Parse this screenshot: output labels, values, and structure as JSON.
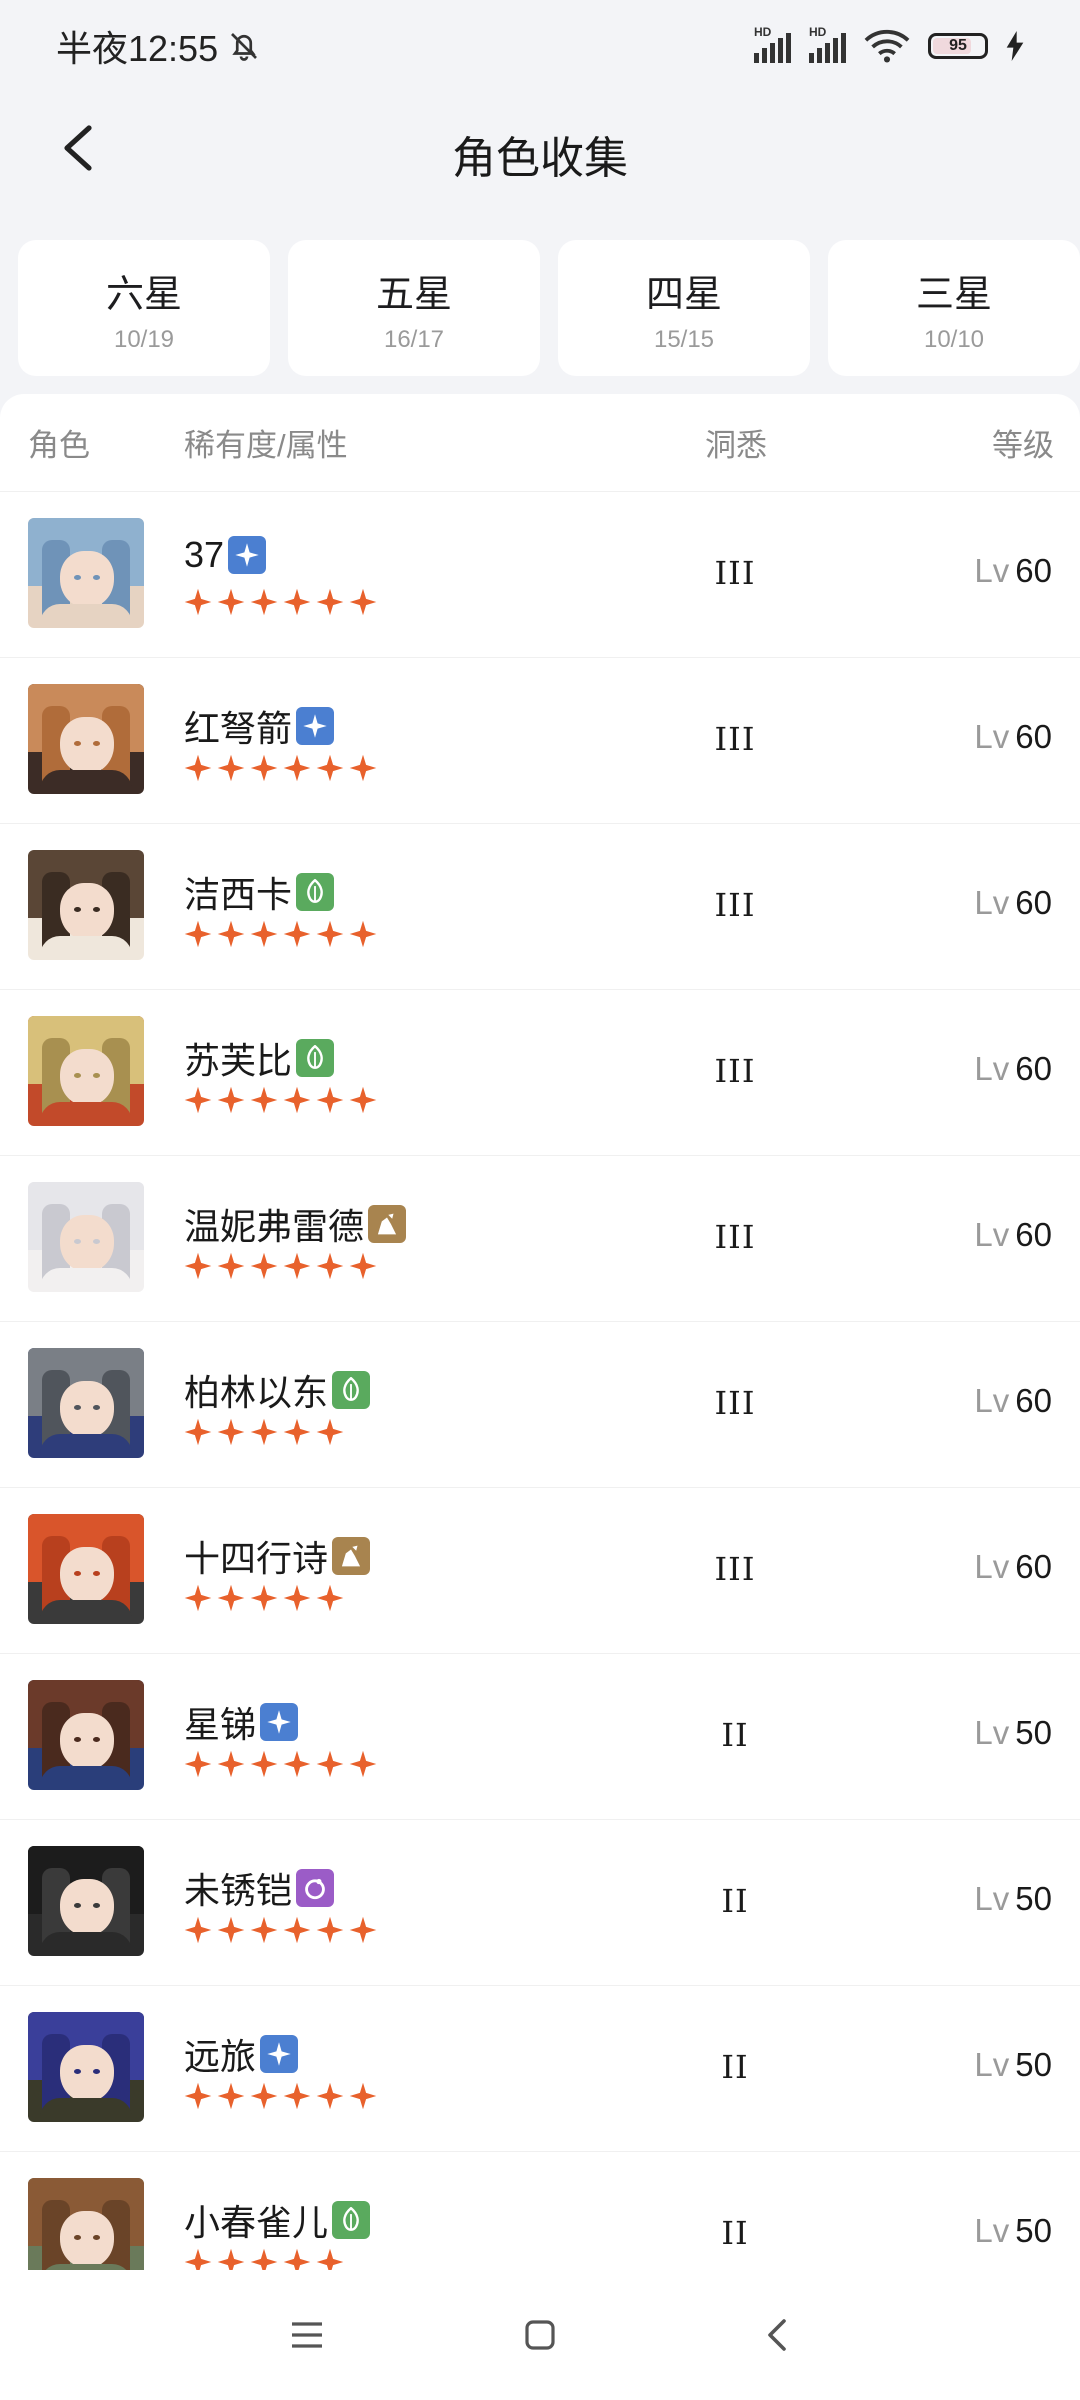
{
  "status_bar": {
    "time": "半夜12:55",
    "network_label": "HD",
    "battery": "95"
  },
  "header": {
    "title": "角色收集"
  },
  "tabs": [
    {
      "label": "六星",
      "count": "10/19"
    },
    {
      "label": "五星",
      "count": "16/17"
    },
    {
      "label": "四星",
      "count": "15/15"
    },
    {
      "label": "三星",
      "count": "10/10"
    }
  ],
  "table": {
    "headers": {
      "character": "角色",
      "rarity": "稀有度/属性",
      "insight": "洞悉",
      "level": "等级"
    },
    "level_prefix": "Lv",
    "rows": [
      {
        "name": "37",
        "attribute": "star",
        "stars": 6,
        "insight": "III",
        "level": "60"
      },
      {
        "name": "红弩箭",
        "attribute": "star",
        "stars": 6,
        "insight": "III",
        "level": "60"
      },
      {
        "name": "洁西卡",
        "attribute": "plant",
        "stars": 6,
        "insight": "III",
        "level": "60"
      },
      {
        "name": "苏芙比",
        "attribute": "plant",
        "stars": 6,
        "insight": "III",
        "level": "60"
      },
      {
        "name": "温妮弗雷德",
        "attribute": "mineral",
        "stars": 6,
        "insight": "III",
        "level": "60"
      },
      {
        "name": "柏林以东",
        "attribute": "plant",
        "stars": 5,
        "insight": "III",
        "level": "60"
      },
      {
        "name": "十四行诗",
        "attribute": "mineral",
        "stars": 5,
        "insight": "III",
        "level": "60"
      },
      {
        "name": "星锑",
        "attribute": "star",
        "stars": 6,
        "insight": "II",
        "level": "50"
      },
      {
        "name": "未锈铠",
        "attribute": "spirit",
        "stars": 6,
        "insight": "II",
        "level": "50"
      },
      {
        "name": "远旅",
        "attribute": "star",
        "stars": 6,
        "insight": "II",
        "level": "50"
      },
      {
        "name": "小春雀儿",
        "attribute": "plant",
        "stars": 5,
        "insight": "II",
        "level": "50"
      }
    ]
  },
  "colors": {
    "star": "#e8612c",
    "attr_star": "#4b7fd1",
    "attr_plant": "#5aaa5e",
    "attr_mineral": "#a8844f",
    "attr_spirit": "#9b5cc7"
  },
  "icons": {
    "back": "chevron-left-icon",
    "nav_menu": "menu-icon",
    "nav_home": "home-square-icon",
    "nav_back": "back-chevron-icon"
  }
}
